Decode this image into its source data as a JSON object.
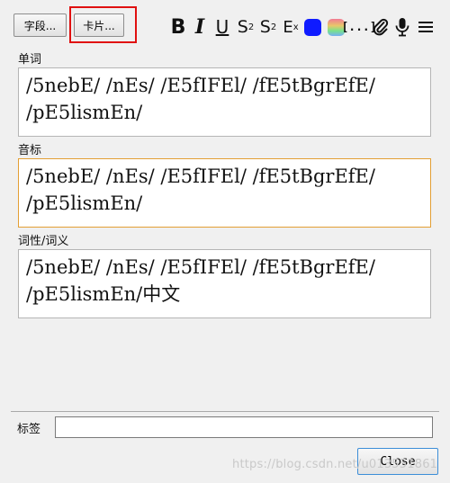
{
  "toolbar": {
    "fields_label": "字段...",
    "cards_label": "卡片...",
    "bold_label": "B",
    "italic_label": "I",
    "underline_label": "U",
    "superscript_label": "S",
    "superscript_mark": "2",
    "subscript_label": "S",
    "subscript_mark": "2",
    "clear_format_label": "E",
    "clear_format_mark": "x",
    "cloze_label": "[...]",
    "text_color": "#0f1bff",
    "icons": [
      "bold-icon",
      "italic-icon",
      "underline-icon",
      "superscript-icon",
      "subscript-icon",
      "clear-formatting-icon",
      "text-color-icon",
      "highlight-color-icon",
      "cloze-icon",
      "attach-icon",
      "record-audio-icon",
      "more-menu-icon"
    ]
  },
  "fields": [
    {
      "label": "单词",
      "value": "/5nebE/ /nEs/ /E5fIFEl/ /fE5tBgrEfE/ /pE5lismEn/"
    },
    {
      "label": "音标",
      "value": "/5nebE/ /nEs/ /E5fIFEl/ /fE5tBgrEfE/ /pE5lismEn/"
    },
    {
      "label": "词性/词义",
      "value": "/5nebE/ /nEs/ /E5fIFEl/ /fE5tBgrEfE/ /pE5lismEn/中文"
    }
  ],
  "tags": {
    "label": "标签",
    "value": ""
  },
  "close_label": "Close",
  "watermark": "https://blog.csdn.net/u013551861",
  "colors": {
    "highlight_box": "#e01010",
    "focus_border": "#e39f34",
    "default_button_border": "#3c8ed8"
  }
}
